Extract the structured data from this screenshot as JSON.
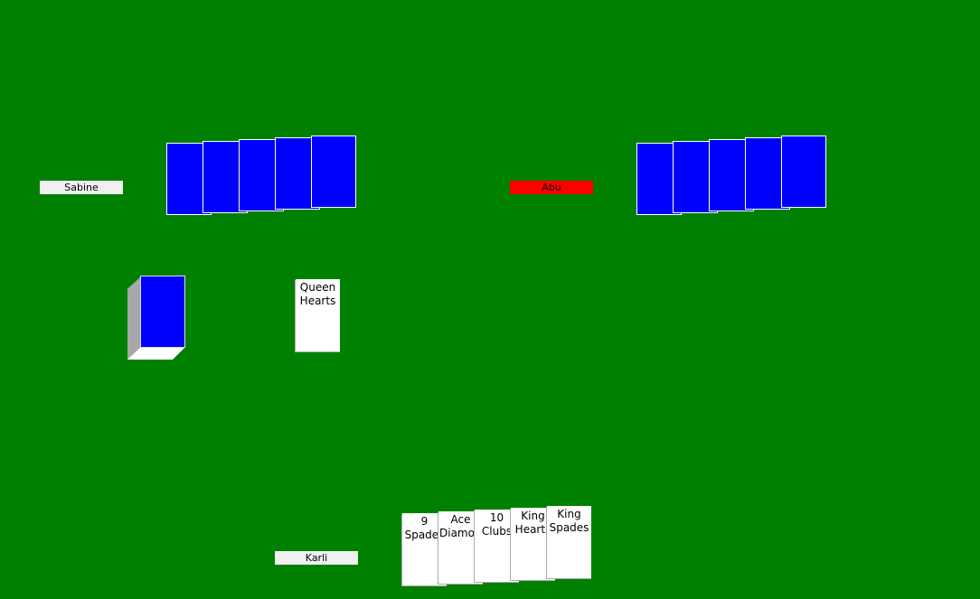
{
  "colors": {
    "felt": "#008000",
    "card_back": "#0000ff",
    "card_face": "#ffffff",
    "name_tag": "#f0f0f0",
    "active_name_tag": "#ff0000"
  },
  "players": {
    "sabine": {
      "name": "Sabine",
      "active": false,
      "hand_count": 5
    },
    "abu": {
      "name": "Abu",
      "active": true,
      "hand_count": 5
    },
    "karli": {
      "name": "Karli",
      "active": false
    }
  },
  "discard_pile": {
    "top_card": "Queen\nHearts"
  },
  "draw_pile": {
    "face": "down"
  },
  "karli_hand": [
    "9 Spades",
    "Ace\nDiamonds",
    "10 Clubs",
    "King\nHearts",
    "King\nSpades"
  ]
}
